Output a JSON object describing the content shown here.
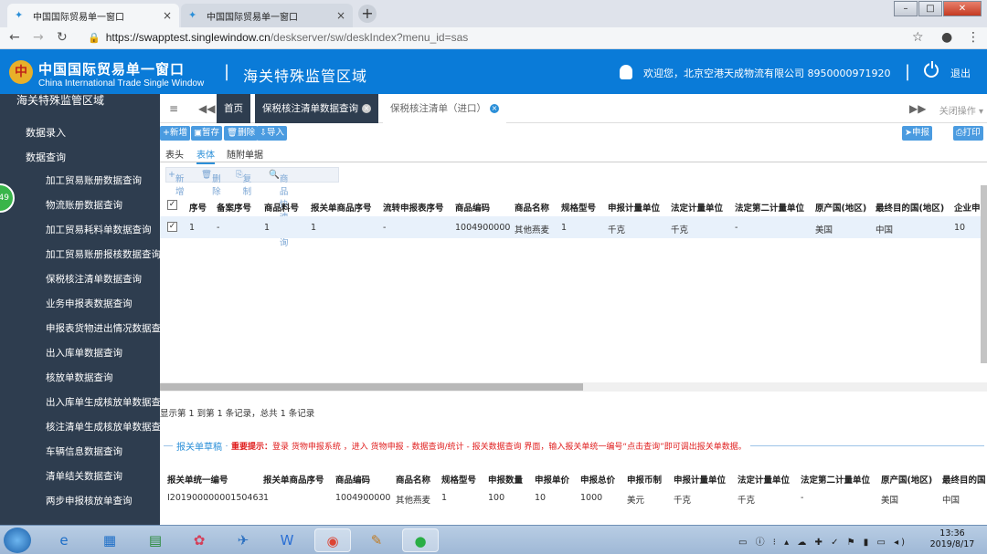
{
  "browser": {
    "tabs": [
      {
        "label": "中国国际贸易单一窗口",
        "close": "×"
      },
      {
        "label": "中国国际贸易单一窗口",
        "close": "×"
      }
    ],
    "new_tab": "+",
    "window_controls": [
      "–",
      "□",
      "✕"
    ],
    "url_host": "https://swapptest.singlewindow.cn",
    "url_path": "/deskserver/sw/deskIndex?menu_id=sas"
  },
  "header": {
    "app_title_cn": "中国国际贸易单一窗口",
    "app_title_en": "China International Trade Single Window",
    "separator": "|",
    "module_title": "海关特殊监管区域",
    "welcome": "欢迎您，北京空港天成物流有限公司 8950000971920",
    "logout": "退出"
  },
  "sidebar": {
    "title": "海关特殊监管区域",
    "sections": [
      "数据录入",
      "数据查询"
    ],
    "items": [
      "加工贸易账册数据查询",
      "物流账册数据查询",
      "加工贸易耗料单数据查询",
      "加工贸易账册报核数据查询",
      "保税核注清单数据查询",
      "业务申报表数据查询",
      "申报表货物进出情况数据查询",
      "出入库单数据查询",
      "核放单数据查询",
      "出入库单生成核放单数据查询",
      "核注清单生成核放单数据查询",
      "车辆信息数据查询",
      "清单结关数据查询",
      "两步申报核放单查询"
    ],
    "badge": "49"
  },
  "tabs": {
    "home": "首页",
    "open": [
      "保税核注清单数据查询",
      "保税核注清单（进口）"
    ],
    "close_ops": "关闭操作"
  },
  "toolbar": {
    "buttons": [
      "新增",
      "暂存",
      "删除",
      "导入"
    ],
    "declare": "申报",
    "print": "打印"
  },
  "subtabs": [
    "表头",
    "表体",
    "随附单据"
  ],
  "body_toolbar": [
    "新增",
    "删除",
    "复制",
    "商品快速查询"
  ],
  "grid": {
    "columns": [
      "序号",
      "备案序号",
      "商品料号",
      "报关单商品序号",
      "流转申报表序号",
      "商品编码",
      "商品名称",
      "规格型号",
      "申报计量单位",
      "法定计量单位",
      "法定第二计量单位",
      "原产国(地区)",
      "最终目的国(地区)",
      "企业申"
    ],
    "rows": [
      [
        "1",
        "-",
        "1",
        "1",
        "-",
        "1004900000",
        "其他燕麦",
        "1",
        "千克",
        "千克",
        "-",
        "美国",
        "中国",
        "10"
      ]
    ]
  },
  "pagination": "显示第 1 到第 1 条记录，总共 1 条记录",
  "draft_section": {
    "legend": "报关单草稿",
    "hint_label": "重要提示：",
    "hint_text": "登录 货物申报系统 ，进入 货物申报 - 数据查询/统计 - 报关数据查询 界面，输入报关单统一编号“点击查询”即可调出报关单数据。",
    "columns": [
      "报关单统一编号",
      "报关单商品序号",
      "商品编码",
      "商品名称",
      "规格型号",
      "申报数量",
      "申报单价",
      "申报总价",
      "申报币制",
      "申报计量单位",
      "法定计量单位",
      "法定第二计量单位",
      "原产国(地区)",
      "最终目的国"
    ],
    "rows": [
      [
        "I20190000000150463",
        "1",
        "1004900000",
        "其他燕麦",
        "1",
        "100",
        "10",
        "1000",
        "美元",
        "千克",
        "千克",
        "-",
        "美国",
        "中国"
      ]
    ]
  },
  "taskbar": {
    "time": "13:36",
    "date": "2019/8/17"
  },
  "colors": {
    "header_blue": "#0a7bd8",
    "sidebar": "#2e3d4f",
    "accent": "#2b8fd8",
    "hint_red": "#e02020"
  }
}
